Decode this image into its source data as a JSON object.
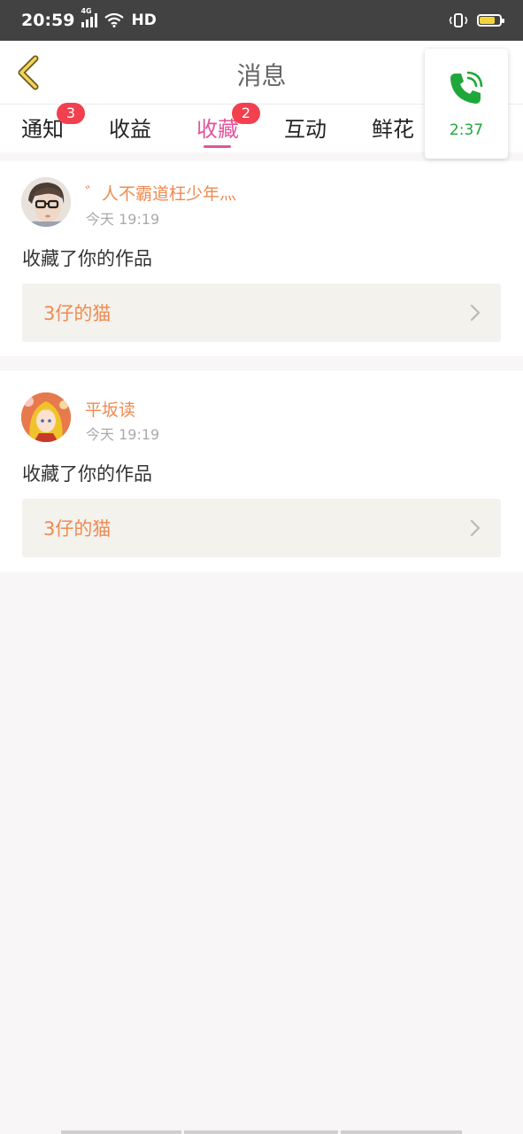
{
  "status_bar": {
    "time": "20:59",
    "network": "4G",
    "hd": "HD"
  },
  "header": {
    "title": "消息",
    "back_icon": "chevron-left-icon"
  },
  "tabs": [
    {
      "label": "通知",
      "badge": "3",
      "active": false
    },
    {
      "label": "收益",
      "badge": "",
      "active": false
    },
    {
      "label": "收藏",
      "badge": "2",
      "active": true
    },
    {
      "label": "互动",
      "badge": "",
      "active": false
    },
    {
      "label": "鲜花",
      "badge": "",
      "active": false
    }
  ],
  "call_widget": {
    "icon": "phone-icon",
    "duration": "2:37"
  },
  "messages": [
    {
      "username": "゛人不霸道枉少年灬",
      "time": "今天 19:19",
      "action": "收藏了你的作品",
      "work_title": "3仔的猫"
    },
    {
      "username": "平坂读",
      "time": "今天 19:19",
      "action": "收藏了你的作品",
      "work_title": "3仔的猫"
    }
  ],
  "colors": {
    "accent": "#e0559a",
    "name": "#ef8a52",
    "badge": "#f2404f",
    "call_green": "#1fa839"
  }
}
